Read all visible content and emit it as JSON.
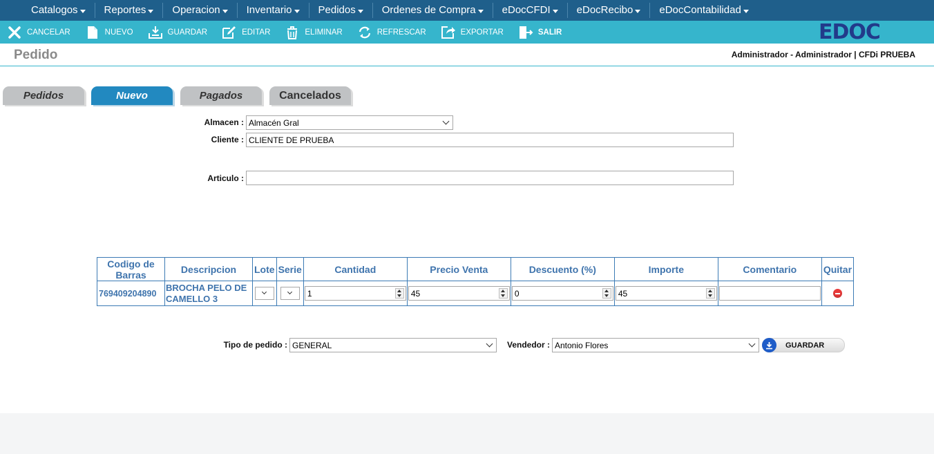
{
  "menu": {
    "items": [
      "Catalogos",
      "Reportes",
      "Operacion",
      "Inventario",
      "Pedidos",
      "Ordenes de Compra",
      "eDocCFDI",
      "eDocRecibo",
      "eDocContabilidad"
    ]
  },
  "toolbar": {
    "cancel": "CANCELAR",
    "new": "NUEVO",
    "save": "GUARDAR",
    "edit": "EDITAR",
    "delete": "ELIMINAR",
    "refresh": "REFRESCAR",
    "export": "EXPORTAR",
    "exit": "SALIR"
  },
  "logo": {
    "text": "EDOC"
  },
  "header": {
    "title": "Pedido",
    "user": "Administrador - Administrador | CFDi PRUEBA"
  },
  "tabs": [
    {
      "label": "Pedidos"
    },
    {
      "label": "Nuevo"
    },
    {
      "label": "Pagados"
    },
    {
      "label": "Cancelados"
    }
  ],
  "form": {
    "almacen_label": "Almacen :",
    "almacen_value": "Almacén Gral",
    "cliente_label": "Cliente :",
    "cliente_value": "CLIENTE DE PRUEBA",
    "articulo_label": "Articulo :",
    "articulo_value": ""
  },
  "table": {
    "headers": [
      "Codigo de Barras",
      "Descripcion",
      "Lote",
      "Serie",
      "Cantidad",
      "Precio Venta",
      "Descuento (%)",
      "Importe",
      "Comentario",
      "Quitar"
    ],
    "rows": [
      {
        "codigo": "769409204890",
        "descripcion": "BROCHA PELO DE CAMELLO 3",
        "cantidad": "1",
        "precio": "45",
        "descuento": "0",
        "importe": "45",
        "comentario": ""
      }
    ]
  },
  "footer": {
    "tipo_label": "Tipo de pedido :",
    "tipo_value": "GENERAL",
    "vendedor_label": "Vendedor :",
    "vendedor_value": "Antonio Flores",
    "save_label": "GUARDAR"
  },
  "colors": {
    "menubar": "#1f5f8b",
    "toolbar": "#36b5cc",
    "active_tab": "#2289c0",
    "grid_text": "#3f74ad",
    "remove": "#e83a3a"
  }
}
